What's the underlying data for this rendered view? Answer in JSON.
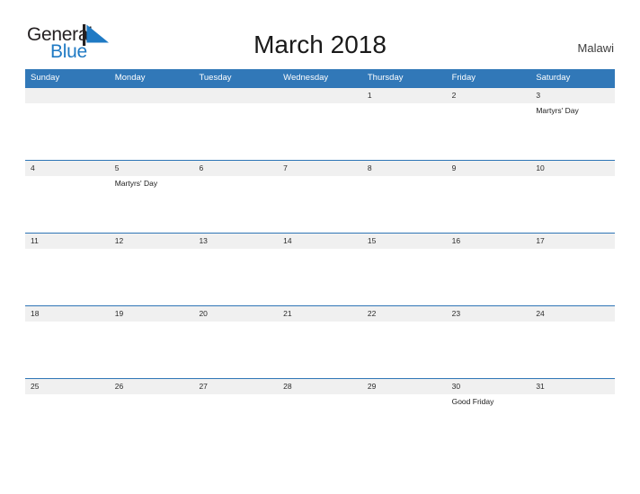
{
  "brand": {
    "name_part1": "General",
    "name_part2": "Blue",
    "mark_icon": "triangle-flag-icon",
    "color_dark": "#231f20",
    "color_blue": "#1f7ac4"
  },
  "header": {
    "title": "March 2018",
    "locale": "Malawi"
  },
  "theme": {
    "header_blue": "#3178b8",
    "separator_blue": "#2e75b6",
    "date_band_gray": "#f0f0f0",
    "page_background": "#ffffff"
  },
  "calendar": {
    "month": "March",
    "year": "2018",
    "weekdays": [
      "Sunday",
      "Monday",
      "Tuesday",
      "Wednesday",
      "Thursday",
      "Friday",
      "Saturday"
    ],
    "weeks": [
      {
        "dates": [
          "",
          "",
          "",
          "",
          "1",
          "2",
          "3"
        ],
        "events": [
          "",
          "",
          "",
          "",
          "",
          "",
          "Martyrs' Day"
        ]
      },
      {
        "dates": [
          "4",
          "5",
          "6",
          "7",
          "8",
          "9",
          "10"
        ],
        "events": [
          "",
          "Martyrs' Day",
          "",
          "",
          "",
          "",
          ""
        ]
      },
      {
        "dates": [
          "11",
          "12",
          "13",
          "14",
          "15",
          "16",
          "17"
        ],
        "events": [
          "",
          "",
          "",
          "",
          "",
          "",
          ""
        ]
      },
      {
        "dates": [
          "18",
          "19",
          "20",
          "21",
          "22",
          "23",
          "24"
        ],
        "events": [
          "",
          "",
          "",
          "",
          "",
          "",
          ""
        ]
      },
      {
        "dates": [
          "25",
          "26",
          "27",
          "28",
          "29",
          "30",
          "31"
        ],
        "events": [
          "",
          "",
          "",
          "",
          "",
          "Good Friday",
          ""
        ]
      }
    ]
  }
}
